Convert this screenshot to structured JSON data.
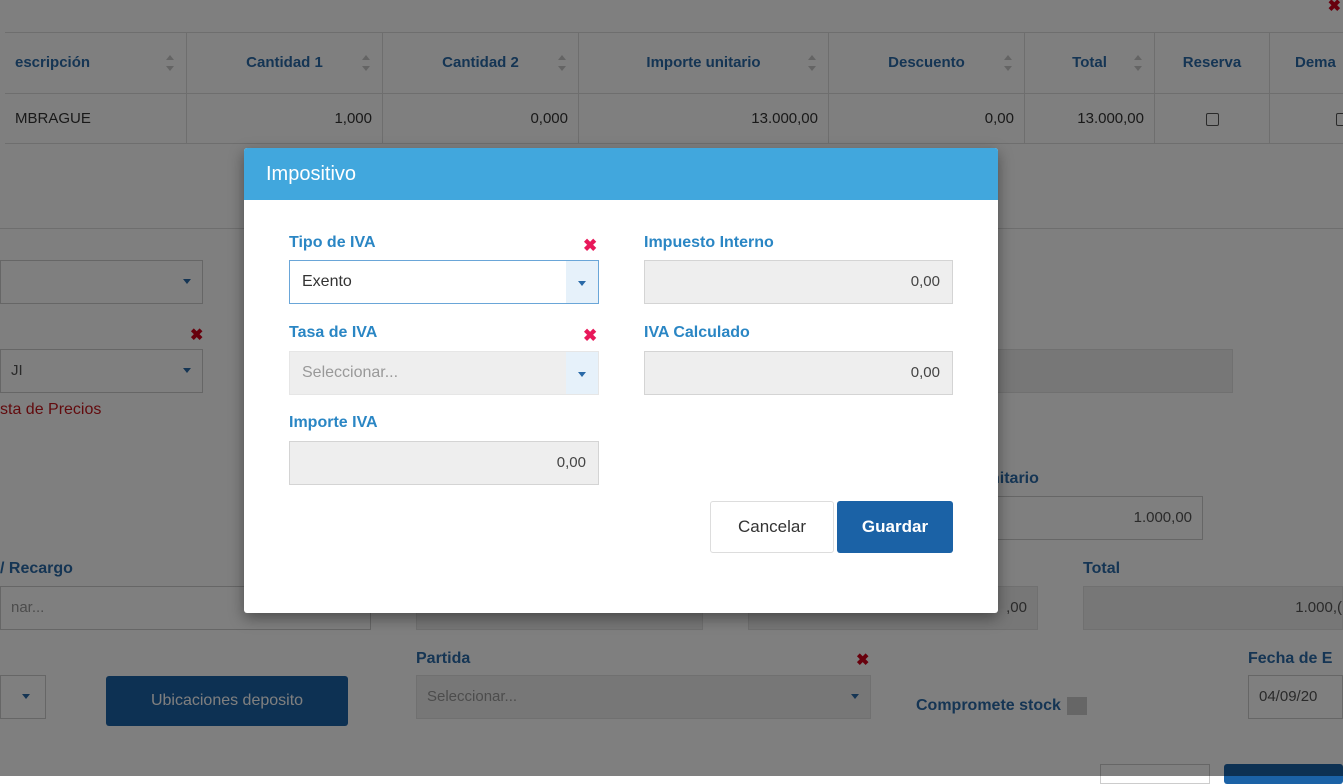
{
  "table": {
    "headers": [
      "escripción",
      "Cantidad 1",
      "Cantidad 2",
      "Importe unitario",
      "Descuento",
      "Total",
      "Reserva",
      "Dema"
    ],
    "row": {
      "descripcion": "MBRAGUE",
      "cantidad1": "1,000",
      "cantidad2": "0,000",
      "importe_unitario": "13.000,00",
      "descuento": "0,00",
      "total": "13.000,00"
    }
  },
  "background": {
    "lista_precios_error": "sta de Precios",
    "selected_value_fragment": "JI",
    "unitario_label": "nitario",
    "unitario_value": "1.000,00",
    "recargo_label": "/ Recargo",
    "recargo_placeholder": "nar...",
    "partial_value": ",00",
    "total_label": "Total",
    "total_value": "1.000,(",
    "partida_label": "Partida",
    "partida_placeholder": "Seleccionar...",
    "fecha_label": "Fecha de E",
    "fecha_value": "04/09/20",
    "ubicaciones_button": "Ubicaciones deposito",
    "compromete_label": "Compromete stock"
  },
  "modal": {
    "title": "Impositivo",
    "tipo_iva": {
      "label": "Tipo de IVA",
      "value": "Exento"
    },
    "tasa_iva": {
      "label": "Tasa de IVA",
      "placeholder": "Seleccionar..."
    },
    "importe_iva": {
      "label": "Importe IVA",
      "value": "0,00"
    },
    "impuesto_interno": {
      "label": "Impuesto Interno",
      "value": "0,00"
    },
    "iva_calculado": {
      "label": "IVA Calculado",
      "value": "0,00"
    },
    "cancel_label": "Cancelar",
    "save_label": "Guardar",
    "required_mark": "✖"
  },
  "colors": {
    "header_blue": "#41a7dd",
    "label_blue": "#2a86c4",
    "primary_button": "#1b62a6",
    "required_red": "#e8185a"
  }
}
